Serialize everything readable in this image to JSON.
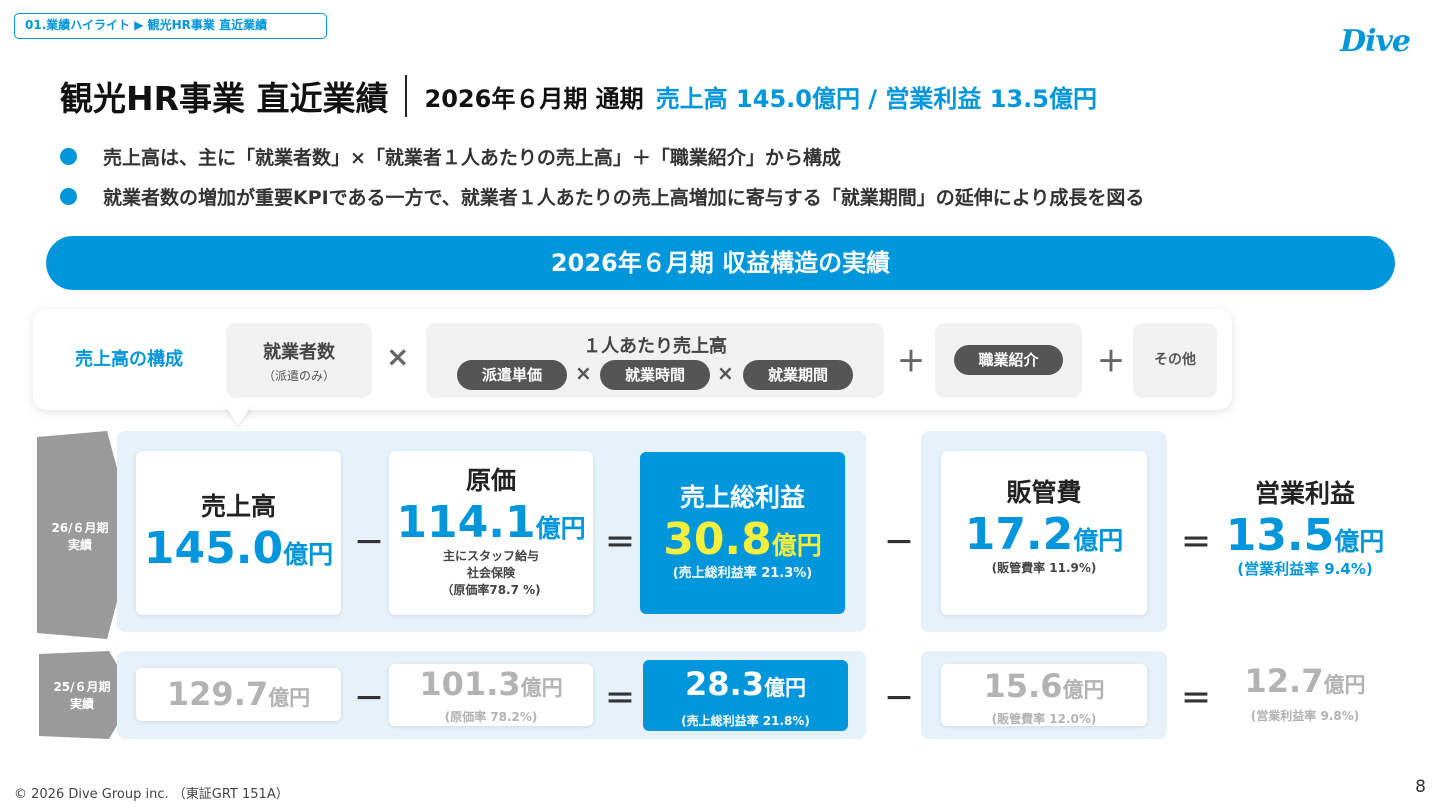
{
  "breadcrumb": "01.業績ハイライト ▶ 観光HR事業 直近業績",
  "logo": "Dive",
  "title": {
    "main": "観光HR事業 直近業績",
    "period": "2026年６月期 通期",
    "result": "売上高 145.0億円 / 営業利益 13.5億円"
  },
  "bullets": [
    "売上高は、主に「就業者数」×「就業者１人あたりの売上高」＋「職業紹介」から構成",
    "就業者数の増加が重要KPIである一方で、就業者１人あたりの売上高増加に寄与する「就業期間」の延伸により成長を図る"
  ],
  "band_title": "2026年６月期 収益構造の実績",
  "composition": {
    "label": "売上高の構成",
    "workers": "就業者数",
    "workers_note": "（派遣のみ）",
    "per_person": "１人あたり売上高",
    "pill_unit_price": "派遣単価",
    "pill_hours": "就業時間",
    "pill_period": "就業期間",
    "pill_placement": "職業紹介",
    "others": "その他",
    "op_times": "×",
    "op_plus": "＋"
  },
  "current": {
    "tag": "26/６月期\n実績",
    "sales_label": "売上高",
    "sales_value": "145.0",
    "cost_label": "原価",
    "cost_value": "114.1",
    "cost_note": "主にスタッフ給与\n社会保険\n（原価率78.7 %)",
    "gross_label": "売上総利益",
    "gross_value": "30.8",
    "gross_note": "(売上総利益率 21.3%)",
    "sga_label": "販管費",
    "sga_value": "17.2",
    "sga_note": "(販管費率 11.9%)",
    "op_label": "営業利益",
    "op_value": "13.5",
    "op_note": "(営業利益率 9.4%)"
  },
  "previous": {
    "tag": "25/６月期\n実績",
    "sales_value": "129.7",
    "cost_value": "101.3",
    "cost_note": "(原価率 78.2%)",
    "gross_value": "28.3",
    "gross_note": "(売上総利益率 21.8%)",
    "sga_value": "15.6",
    "sga_note": "(販管費率 12.0%)",
    "op_value": "12.7",
    "op_note": "(営業利益率 9.8%)"
  },
  "unit": "億円",
  "ops": {
    "minus": "－",
    "equals": "＝"
  },
  "footer": "© 2026 Dive Group inc. （東証GRT 151A）",
  "page_number": "8",
  "colors": {
    "accent": "#0096dc",
    "highlight": "#f3ef3c",
    "panel": "#e6f1fa",
    "tag": "#9a9a9a"
  }
}
